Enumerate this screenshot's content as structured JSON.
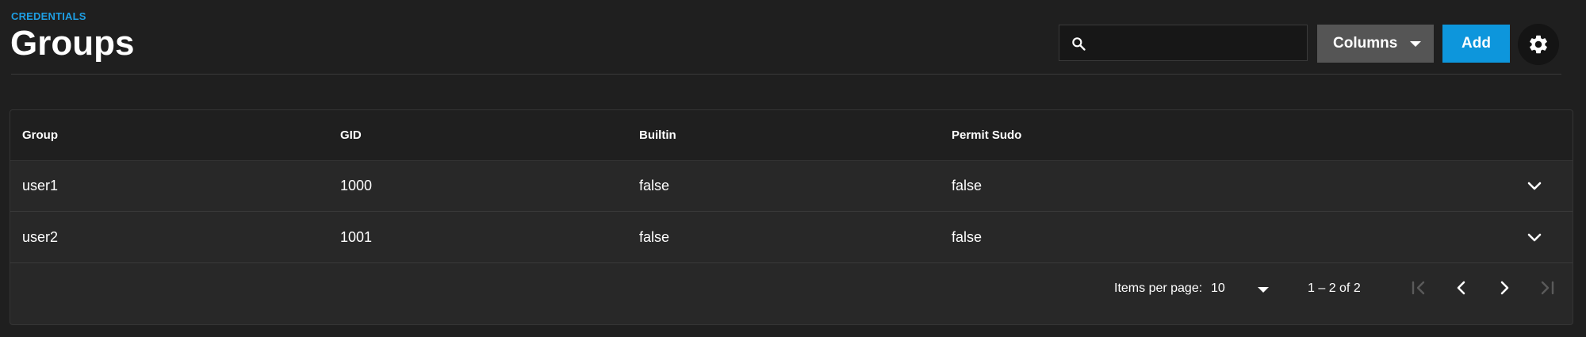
{
  "header": {
    "breadcrumb": "CREDENTIALS",
    "title": "Groups",
    "search_placeholder": "",
    "columns_label": "Columns",
    "add_label": "Add"
  },
  "table": {
    "columns": [
      "Group",
      "GID",
      "Builtin",
      "Permit Sudo"
    ],
    "rows": [
      {
        "group": "user1",
        "gid": "1000",
        "builtin": "false",
        "sudo": "false"
      },
      {
        "group": "user2",
        "gid": "1001",
        "builtin": "false",
        "sudo": "false"
      }
    ]
  },
  "paginator": {
    "items_per_page_label": "Items per page:",
    "items_per_page_value": "10",
    "range_label": "1 – 2 of 2"
  },
  "colors": {
    "accent": "#0d96dc",
    "breadcrumb": "#1e9ee3",
    "background": "#1f1f1f"
  },
  "icons": [
    "search-icon",
    "chevron-down-icon",
    "settings-gear-icon",
    "first-page-icon",
    "previous-page-icon",
    "next-page-icon",
    "last-page-icon"
  ]
}
